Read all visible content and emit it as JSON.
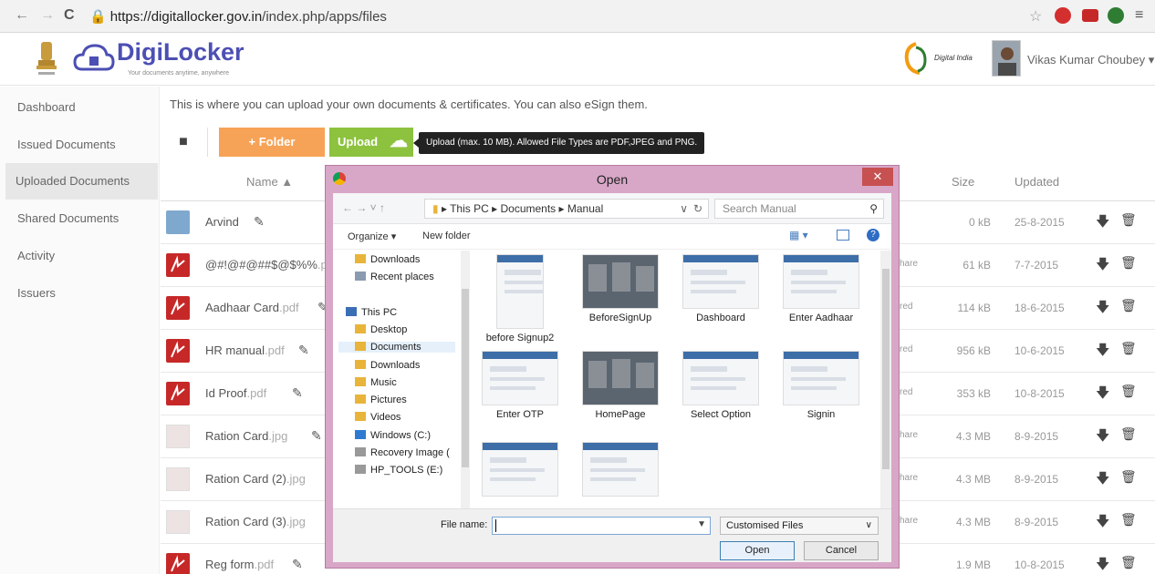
{
  "browser": {
    "url_host": "https://digitallocker.gov.in",
    "url_path": "/index.php/apps/files"
  },
  "header": {
    "brand": "DigiLocker",
    "tagline": "Your documents anytime, anywhere",
    "partner_logo": "Digital India",
    "user_name": "Vikas Kumar Choubey ▾"
  },
  "sidebar": {
    "items": [
      {
        "label": "Dashboard"
      },
      {
        "label": "Issued Documents"
      },
      {
        "label": "Uploaded Documents"
      },
      {
        "label": "Shared Documents"
      },
      {
        "label": "Activity"
      },
      {
        "label": "Issuers"
      }
    ]
  },
  "main": {
    "intro": "This is where you can upload your own documents & certificates. You can also eSign them.",
    "folder_button": "+ Folder",
    "upload_button": "Upload",
    "upload_tip": "Upload (max. 10 MB). Allowed File Types are PDF,JPEG and PNG.",
    "columns": {
      "name": "Name ▲",
      "size": "Size",
      "updated": "Updated"
    },
    "rows": [
      {
        "name": "Arvind",
        "ext": "",
        "type": "folder",
        "share": "",
        "size": "0 kB",
        "date": "25-8-2015"
      },
      {
        "name": "@#!@#@##$@$%%",
        "ext": ".pdf",
        "type": "pdf",
        "share": "hare",
        "size": "61 kB",
        "date": "7-7-2015"
      },
      {
        "name": "Aadhaar Card",
        "ext": ".pdf",
        "type": "pdf",
        "share": "red",
        "size": "114 kB",
        "date": "18-6-2015"
      },
      {
        "name": "HR manual",
        "ext": ".pdf",
        "type": "pdf",
        "share": "red",
        "size": "956 kB",
        "date": "10-6-2015"
      },
      {
        "name": "Id Proof",
        "ext": ".pdf",
        "type": "pdf",
        "share": "red",
        "size": "353 kB",
        "date": "10-8-2015"
      },
      {
        "name": "Ration Card",
        "ext": ".jpg",
        "type": "img",
        "share": "hare",
        "size": "4.3 MB",
        "date": "8-9-2015"
      },
      {
        "name": "Ration Card (2)",
        "ext": ".jpg",
        "type": "img",
        "share": "hare",
        "size": "4.3 MB",
        "date": "8-9-2015"
      },
      {
        "name": "Ration Card (3)",
        "ext": ".jpg",
        "type": "img",
        "share": "hare",
        "size": "4.3 MB",
        "date": "8-9-2015"
      },
      {
        "name": "Reg form",
        "ext": ".pdf",
        "type": "pdf",
        "share": "",
        "size": "1.9 MB",
        "date": "10-8-2015"
      }
    ]
  },
  "dialog": {
    "title": "Open",
    "close": "✕",
    "path": [
      "This PC",
      "Documents",
      "Manual"
    ],
    "search_placeholder": "Search Manual",
    "organize": "Organize ▾",
    "new_folder": "New folder",
    "tree": [
      {
        "label": "Downloads",
        "icon": "downloads-icon"
      },
      {
        "label": "Recent places",
        "icon": "recent-places-icon"
      },
      {
        "label": "This PC",
        "icon": "pc-icon"
      },
      {
        "label": "Desktop",
        "icon": "desktop-folder-icon"
      },
      {
        "label": "Documents",
        "icon": "documents-folder-icon"
      },
      {
        "label": "Downloads",
        "icon": "downloads-folder-icon"
      },
      {
        "label": "Music",
        "icon": "music-folder-icon"
      },
      {
        "label": "Pictures",
        "icon": "pictures-folder-icon"
      },
      {
        "label": "Videos",
        "icon": "videos-folder-icon"
      },
      {
        "label": "Windows (C:)",
        "icon": "drive-icon"
      },
      {
        "label": "Recovery Image (",
        "icon": "drive-icon"
      },
      {
        "label": "HP_TOOLS (E:)",
        "icon": "drive-icon"
      }
    ],
    "files": [
      {
        "label": "before Signup2"
      },
      {
        "label": "BeforeSignUp"
      },
      {
        "label": "Dashboard"
      },
      {
        "label": "Enter Aadhaar"
      },
      {
        "label": "Enter OTP"
      },
      {
        "label": "HomePage"
      },
      {
        "label": "Select Option"
      },
      {
        "label": "Signin"
      },
      {
        "label": ""
      },
      {
        "label": ""
      }
    ],
    "file_name_label": "File name:",
    "file_name_value": "",
    "file_type": "Customised Files",
    "open_button": "Open",
    "cancel_button": "Cancel"
  },
  "colors": {
    "brand": "#4c4fb3",
    "folder_btn": "#f7a357",
    "upload_btn": "#8dc23f",
    "pdf": "#c62828",
    "dialog_frame": "#d8a7c8"
  }
}
